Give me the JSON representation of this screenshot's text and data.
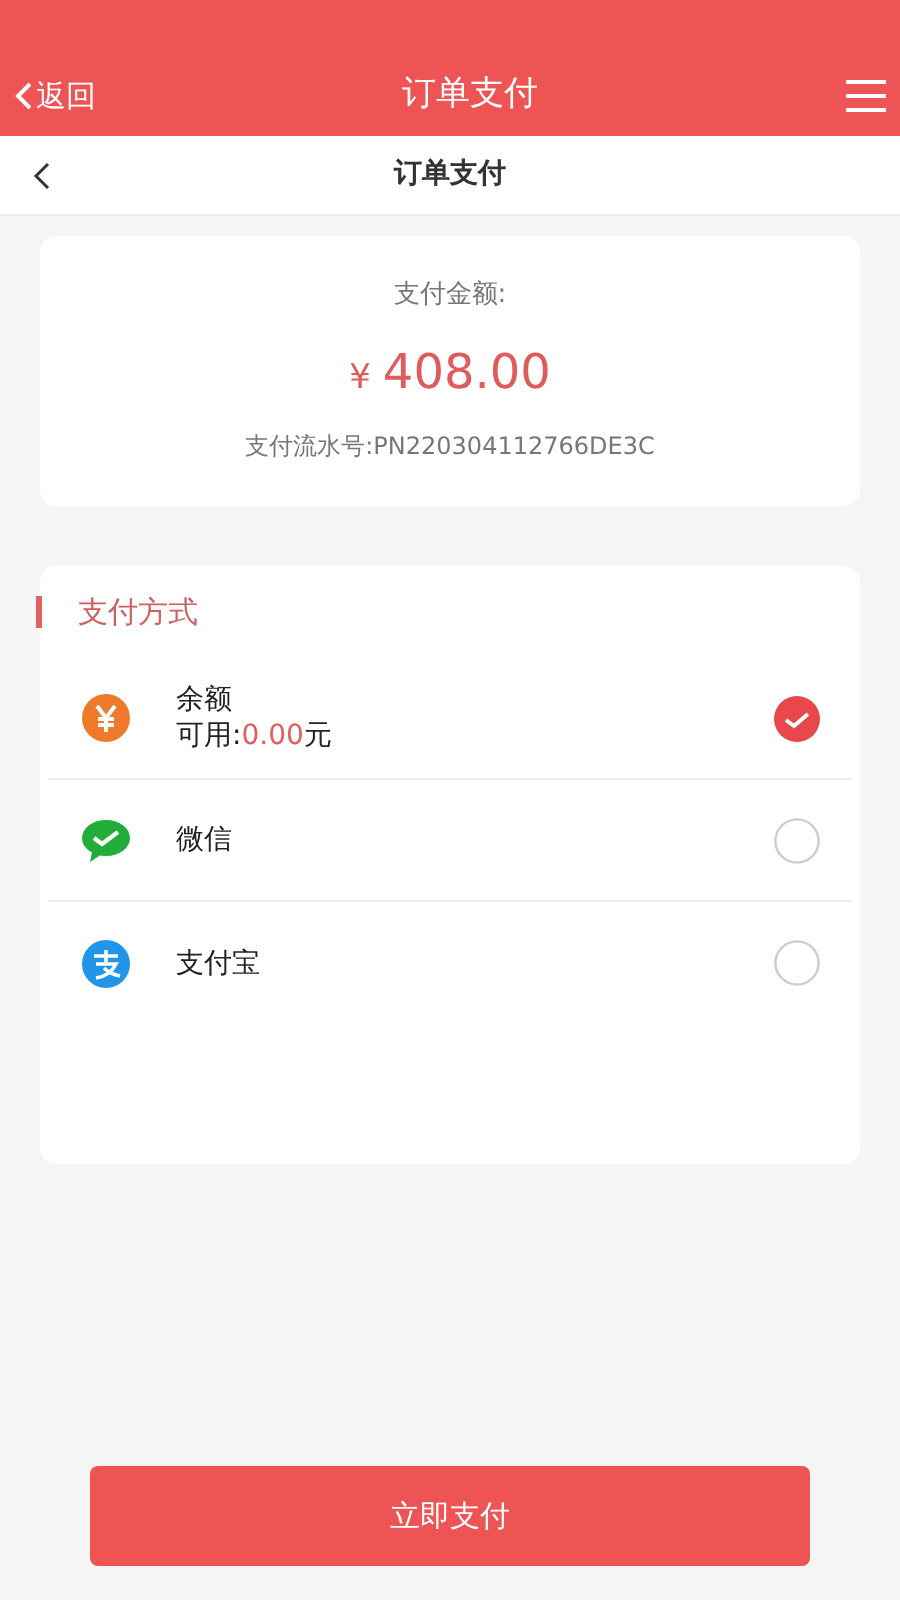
{
  "header": {
    "back": "返回",
    "title": "订单支付"
  },
  "subheader": {
    "title": "订单支付"
  },
  "amount_card": {
    "label": "支付金额:",
    "currency": "¥",
    "amount": "408.00",
    "serial": "支付流水号:PN220304112766DE3C"
  },
  "payment": {
    "title": "支付方式",
    "methods": [
      {
        "kind": "balance",
        "name": "余额",
        "available_label": "可用:",
        "available_amount": "0.00",
        "available_unit": "元",
        "selected": true
      },
      {
        "kind": "wechat",
        "name": "微信",
        "selected": false
      },
      {
        "kind": "alipay",
        "name": "支付宝",
        "selected": false
      }
    ]
  },
  "pay_button": "立即支付"
}
